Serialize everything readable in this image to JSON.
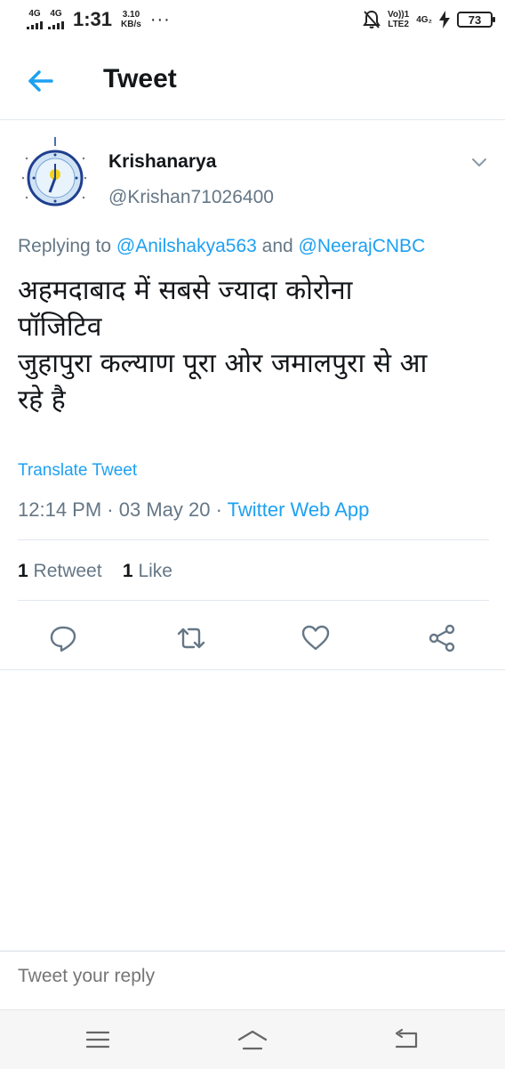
{
  "status_bar": {
    "sim1": "4G",
    "sim2": "4G",
    "time": "1:31",
    "speed_value": "3.10",
    "speed_unit": "KB/s",
    "more": "···",
    "volte_top": "Vo))1",
    "volte_bottom": "LTE2",
    "net_right": "4G₂",
    "battery": "73"
  },
  "header": {
    "title": "Tweet"
  },
  "tweet": {
    "name": "Krishanarya",
    "handle": "@Krishan71026400",
    "replying_prefix": "Replying to ",
    "reply_user1": "@Anilshakya563",
    "reply_and": " and ",
    "reply_user2": "@NeerajCNBC",
    "body_lines": [
      "अहमदाबाद में सबसे ज्यादा कोरोना",
      "पॉजिटिव",
      "जुहापुरा कल्याण पूरा ओर जमालपुरा से आ",
      "रहे है"
    ],
    "translate": "Translate Tweet",
    "time": "12:14 PM",
    "sep": " · ",
    "date": "03 May 20",
    "source": "Twitter Web App",
    "retweet_count": "1",
    "retweet_label": "Retweet",
    "like_count": "1",
    "like_label": "Like"
  },
  "reply_box": {
    "placeholder": "Tweet your reply"
  },
  "icons": {
    "back": "arrow-left",
    "caret": "chevron-down",
    "reply": "speech-bubble",
    "retweet": "retweet-arrows",
    "like": "heart",
    "share": "share-nodes",
    "nav_menu": "menu-lines",
    "nav_home": "home",
    "nav_back": "return-arrow"
  },
  "colors": {
    "accent": "#1da1f2",
    "secondary_text": "#657786",
    "primary_text": "#14171a"
  }
}
